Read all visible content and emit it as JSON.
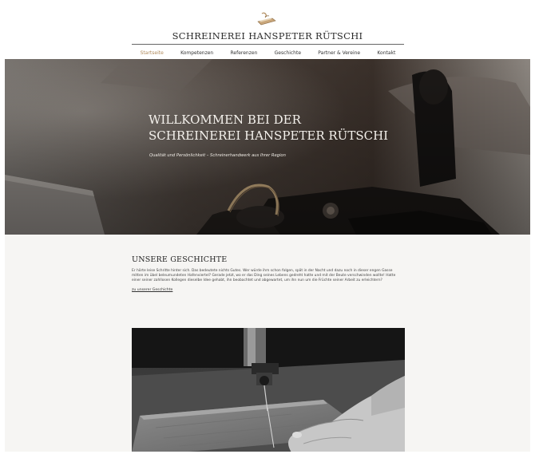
{
  "header": {
    "brand": "SCHREINEREI HANSPETER RÜTSCHI",
    "logo_icon": "wood-plane-icon"
  },
  "nav": {
    "items": [
      {
        "label": "Startseite",
        "active": true
      },
      {
        "label": "Kompetenzen",
        "active": false
      },
      {
        "label": "Referenzen",
        "active": false
      },
      {
        "label": "Geschichte",
        "active": false
      },
      {
        "label": "Partner & Vereine",
        "active": false
      },
      {
        "label": "Kontakt",
        "active": false
      }
    ]
  },
  "hero": {
    "title_line1": "WILLKOMMEN BEI DER",
    "title_line2": "SCHREINEREI HANSPETER RÜTSCHI",
    "subtitle": "Qualität und Persönlichkeit – Schreinerhandwerk aus Ihrer Region"
  },
  "story": {
    "title": "UNSERE GESCHICHTE",
    "text": "Er hörte leise Schritte hinter sich. Das bedeutete nichts Gutes. Wer würde ihm schon folgen, spät in der Nacht und dazu noch in dieser engen Gasse mitten im übel beleumundeten Hafenviertel? Gerade jetzt, wo er das Ding seines Lebens gedreht hatte und mit der Beute verschwinden wollte! Hatte einer seiner zahllosen Kollegen dieselbe Idee gehabt, ihn beobachtet und abgewartet, um ihn nun um die Früchte seiner Arbeit zu erleichtern?",
    "link": "zu unserer Geschichte"
  },
  "colors": {
    "accent": "#b08a5b",
    "page_bg": "#f6f5f3",
    "header_bg": "#ffffff",
    "text": "#222222"
  }
}
